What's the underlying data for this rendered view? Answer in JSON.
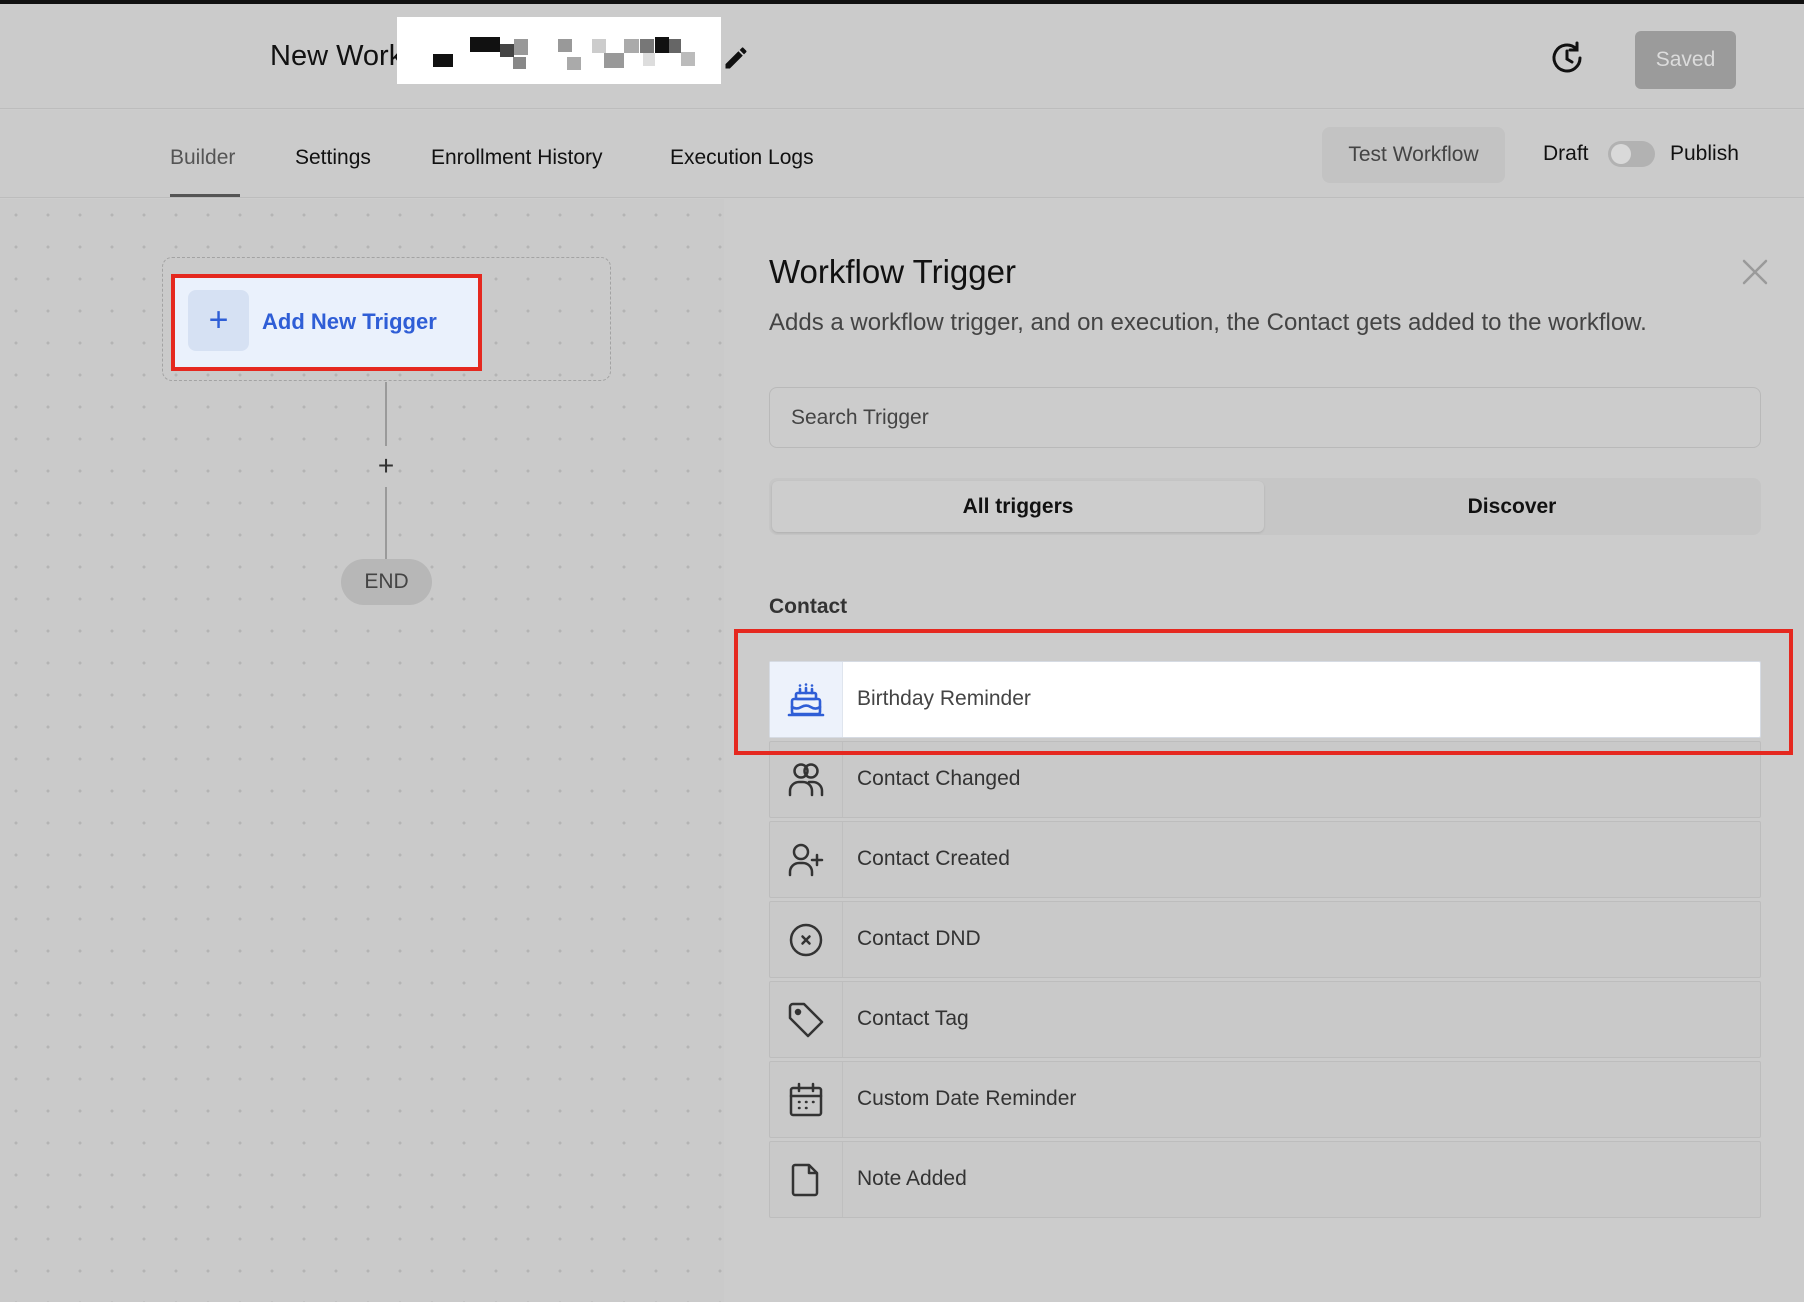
{
  "header": {
    "workflow_title": "New Work",
    "edit_icon": "pencil-icon",
    "history_icon": "clock-history-icon",
    "saved_label": "Saved"
  },
  "tabs": [
    {
      "label": "Builder",
      "active": true
    },
    {
      "label": "Settings",
      "active": false
    },
    {
      "label": "Enrollment History",
      "active": false
    },
    {
      "label": "Execution Logs",
      "active": false
    }
  ],
  "actions": {
    "test_label": "Test Workflow",
    "draft_label": "Draft",
    "publish_label": "Publish",
    "publish_toggle_on": false
  },
  "canvas": {
    "add_trigger_label": "Add New Trigger",
    "add_step_symbol": "+",
    "end_label": "END"
  },
  "panel": {
    "title": "Workflow Trigger",
    "description": "Adds a workflow trigger, and on execution, the Contact gets added to the workflow.",
    "search_placeholder": "Search Trigger",
    "segments": [
      "All triggers",
      "Discover"
    ],
    "section": "Contact",
    "items": [
      {
        "label": "Birthday Reminder",
        "icon": "birthday-cake-icon",
        "highlighted": true
      },
      {
        "label": "Contact Changed",
        "icon": "users-icon",
        "highlighted": false
      },
      {
        "label": "Contact Created",
        "icon": "user-plus-icon",
        "highlighted": false
      },
      {
        "label": "Contact DND",
        "icon": "circle-x-icon",
        "highlighted": false
      },
      {
        "label": "Contact Tag",
        "icon": "tag-icon",
        "highlighted": false
      },
      {
        "label": "Custom Date Reminder",
        "icon": "calendar-icon",
        "highlighted": false
      },
      {
        "label": "Note Added",
        "icon": "file-icon",
        "highlighted": false
      }
    ]
  },
  "colors": {
    "accent_blue": "#2f5ed6",
    "highlight_red": "#e5281f",
    "overlay_gray": "#cccccc"
  }
}
